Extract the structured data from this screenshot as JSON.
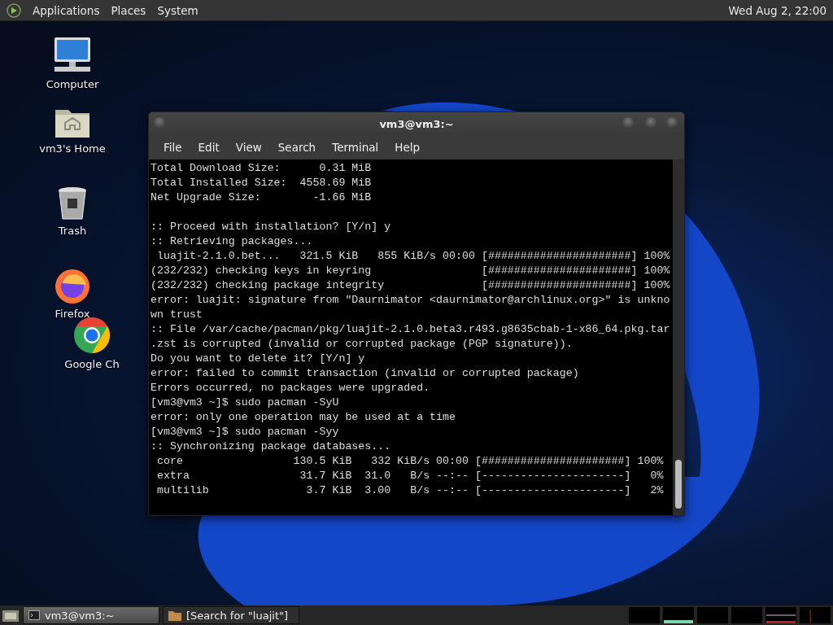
{
  "top_panel": {
    "menus": [
      "Applications",
      "Places",
      "System"
    ],
    "clock": "Wed Aug  2, 22:00"
  },
  "desktop_icons": [
    {
      "kind": "computer",
      "label": "Computer"
    },
    {
      "kind": "home",
      "label": "vm3's Home"
    },
    {
      "kind": "trash",
      "label": "Trash"
    },
    {
      "kind": "firefox",
      "label": "Firefox"
    },
    {
      "kind": "chrome",
      "label": "Google Ch"
    }
  ],
  "window": {
    "title": "vm3@vm3:~",
    "menu": [
      "File",
      "Edit",
      "View",
      "Search",
      "Terminal",
      "Help"
    ],
    "output_blocks": [
      [
        "Total Download Size:      0.31 MiB",
        "Total Installed Size:  4558.69 MiB",
        "Net Upgrade Size:        -1.66 MiB"
      ],
      [
        ":: Proceed with installation? [Y/n] y",
        ":: Retrieving packages...",
        " luajit-2.1.0.bet...   321.5 KiB   855 KiB/s 00:00 [######################] 100%",
        "(232/232) checking keys in keyring                 [######################] 100%",
        "(232/232) checking package integrity               [######################] 100%",
        "error: luajit: signature from \"Daurnimator <daurnimator@archlinux.org>\" is unkno",
        "wn trust",
        ":: File /var/cache/pacman/pkg/luajit-2.1.0.beta3.r493.g8635cbab-1-x86_64.pkg.tar",
        ".zst is corrupted (invalid or corrupted package (PGP signature)).",
        "Do you want to delete it? [Y/n] y",
        "error: failed to commit transaction (invalid or corrupted package)",
        "Errors occurred, no packages were upgraded.",
        "[vm3@vm3 ~]$ sudo pacman -SyU",
        "error: only one operation may be used at a time",
        "[vm3@vm3 ~]$ sudo pacman -Syy",
        ":: Synchronizing package databases...",
        " core                 130.5 KiB   332 KiB/s 00:00 [######################] 100%",
        " extra                 31.7 KiB  31.0   B/s --:-- [----------------------]   0%",
        " multilib               3.7 KiB  3.00   B/s --:-- [----------------------]   2%"
      ]
    ]
  },
  "taskbar": {
    "tasks": [
      {
        "kind": "terminal",
        "label": "vm3@vm3:~",
        "selected": true
      },
      {
        "kind": "folder",
        "label": "[Search for \"luajit\"]",
        "selected": false
      }
    ]
  }
}
